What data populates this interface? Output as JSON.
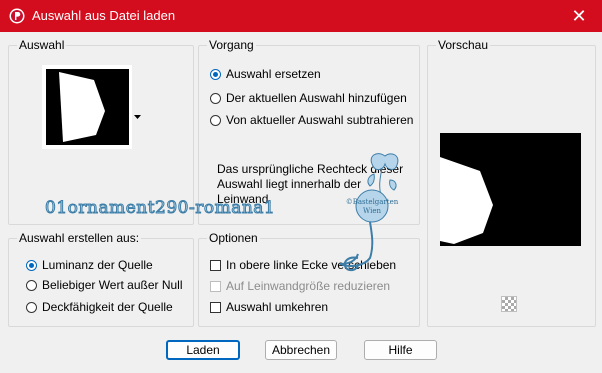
{
  "window": {
    "title": "Auswahl aus Datei laden",
    "close_glyph": "✕"
  },
  "auswahl": {
    "legend": "Auswahl"
  },
  "vorgang": {
    "legend": "Vorgang",
    "options": [
      {
        "label": "Auswahl ersetzen",
        "selected": true
      },
      {
        "label": "Der aktuellen Auswahl hinzufügen",
        "selected": false
      },
      {
        "label": "Von aktueller Auswahl subtrahieren",
        "selected": false
      }
    ],
    "info_line1": "Das ursprüngliche Rechteck dieser",
    "info_line2": "Auswahl liegt innerhalb der",
    "info_line3": "Leinwand."
  },
  "vorschau": {
    "legend": "Vorschau"
  },
  "erstellen": {
    "legend": "Auswahl erstellen aus:",
    "options": [
      {
        "label": "Luminanz der Quelle",
        "selected": true
      },
      {
        "label": "Beliebiger Wert außer Null",
        "selected": false
      },
      {
        "label": "Deckfähigkeit der Quelle",
        "selected": false
      }
    ]
  },
  "optionen": {
    "legend": "Optionen",
    "items": [
      {
        "label": "In obere linke Ecke verschieben",
        "checked": false,
        "enabled": true
      },
      {
        "label": "Auf Leinwandgröße reduzieren",
        "checked": false,
        "enabled": false
      },
      {
        "label": "Auswahl umkehren",
        "checked": false,
        "enabled": true
      }
    ]
  },
  "buttons": {
    "load": "Laden",
    "cancel": "Abbrechen",
    "help": "Hilfe"
  },
  "watermark": {
    "text": "01ornament290-romana1",
    "stamp_line1": "©Bastelgarten",
    "stamp_line2": "Wien"
  },
  "colors": {
    "titlebar": "#d30d1d",
    "accent": "#0067c0"
  }
}
